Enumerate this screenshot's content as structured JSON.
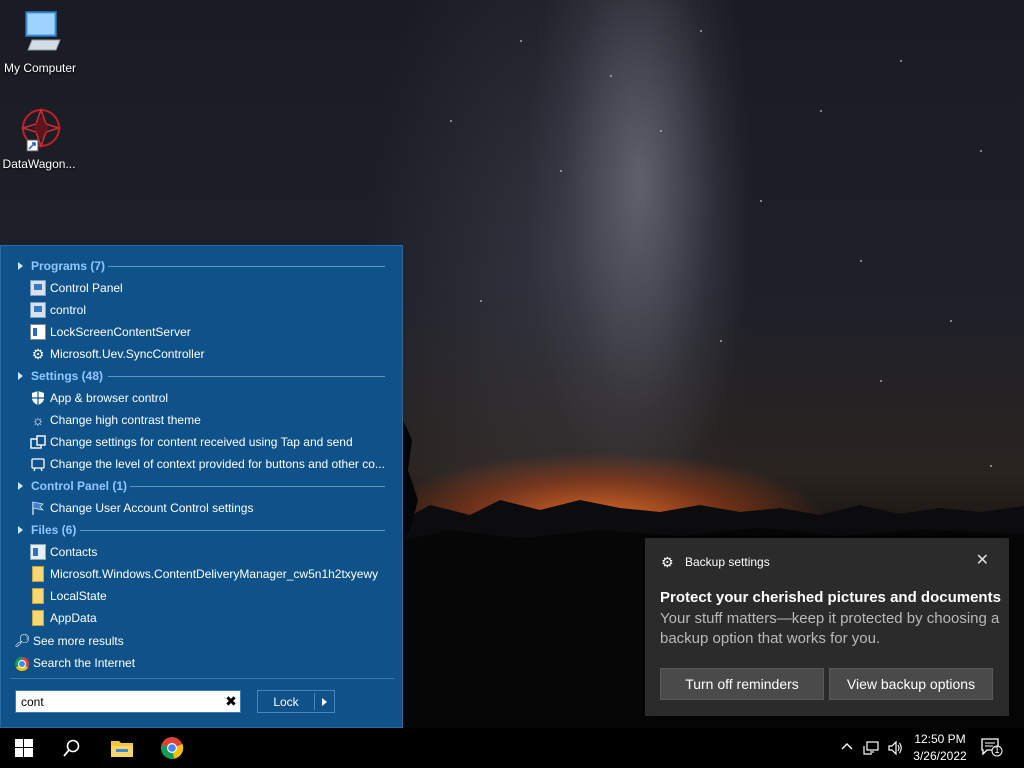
{
  "desktop": {
    "icons": [
      {
        "label": "My Computer",
        "icon": "computer-icon"
      },
      {
        "label": "DataWagon...",
        "icon": "datawagon-shortcut-icon"
      }
    ]
  },
  "start_menu": {
    "sections": [
      {
        "header": "Programs (7)",
        "items": [
          {
            "label": "Control Panel",
            "icon": "control-panel-icon"
          },
          {
            "label": "control",
            "icon": "control-panel-icon"
          },
          {
            "label": "LockScreenContentServer",
            "icon": "app-window-icon"
          },
          {
            "label": "Microsoft.Uev.SyncController",
            "icon": "sync-icon"
          }
        ]
      },
      {
        "header": "Settings (48)",
        "items": [
          {
            "label": "App & browser control",
            "icon": "shield-icon"
          },
          {
            "label": "Change high contrast theme",
            "icon": "sun-icon"
          },
          {
            "label": "Change settings for content received using Tap and send",
            "icon": "tap-send-icon"
          },
          {
            "label": "Change the level of context provided for buttons and other co...",
            "icon": "accessibility-icon"
          }
        ]
      },
      {
        "header": "Control Panel (1)",
        "items": [
          {
            "label": "Change User Account Control settings",
            "icon": "flag-icon"
          }
        ]
      },
      {
        "header": "Files (6)",
        "items": [
          {
            "label": "Contacts",
            "icon": "contacts-icon"
          },
          {
            "label": "Microsoft.Windows.ContentDeliveryManager_cw5n1h2txyewy",
            "icon": "folder-icon"
          },
          {
            "label": "LocalState",
            "icon": "folder-icon"
          },
          {
            "label": "AppData",
            "icon": "folder-icon"
          }
        ]
      }
    ],
    "see_more": "See more results",
    "search_internet": "Search the Internet",
    "search_value": "cont",
    "lock_label": "Lock"
  },
  "toast": {
    "app_name": "Backup settings",
    "title": "Protect your cherished pictures and documents",
    "body": "Your stuff matters—keep it protected by choosing a backup option that works for you.",
    "button_off": "Turn off reminders",
    "button_view": "View backup options"
  },
  "taskbar": {
    "time": "12:50 PM",
    "date": "3/26/2022",
    "notification_count": "1"
  }
}
